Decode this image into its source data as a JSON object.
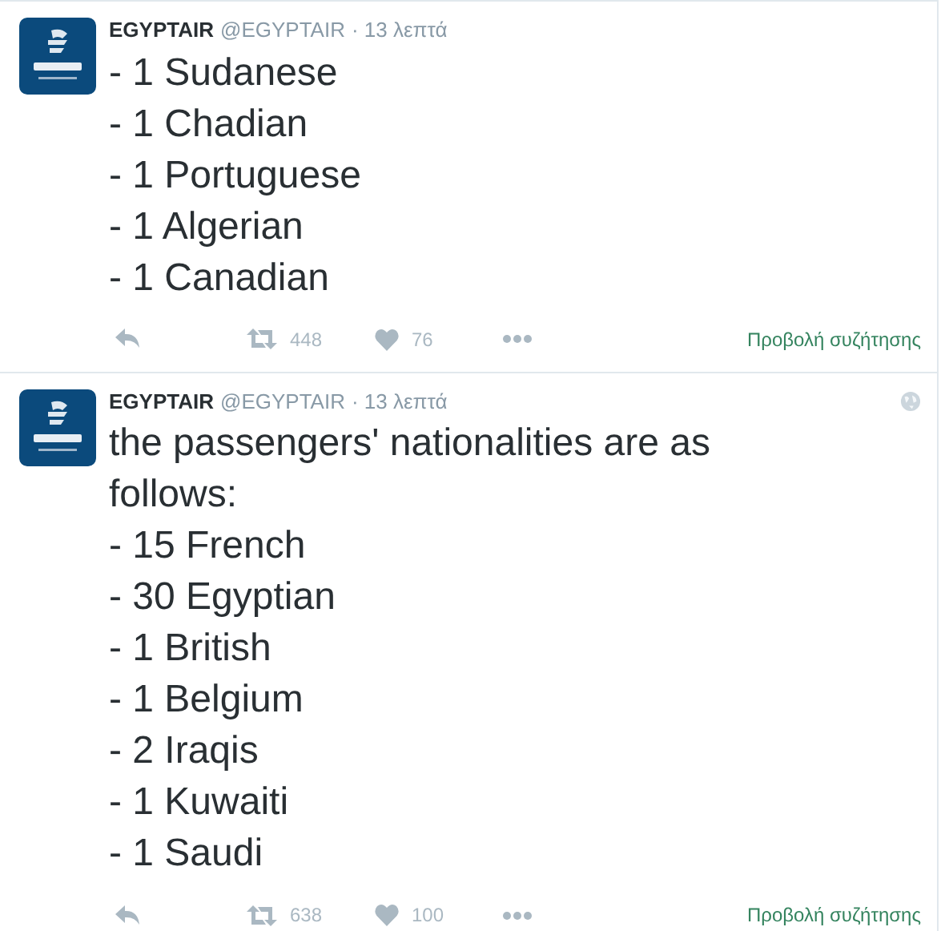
{
  "tweets": [
    {
      "name": "EGYPTAIR",
      "handle": "@EGYPTAIR",
      "time": "· 13 λεπτά",
      "globe": false,
      "text": "- 1 Sudanese\n- 1 Chadian\n- 1 Portuguese\n- 1 Algerian\n- 1 Canadian",
      "retweets": "448",
      "likes": "76",
      "conversation_link": "Προβολή συζήτησης"
    },
    {
      "name": "EGYPTAIR",
      "handle": "@EGYPTAIR",
      "time": "· 13 λεπτά",
      "globe": true,
      "text": "the passengers' nationalities are as follows:\n- 15 French\n- 30 Egyptian\n- 1 British\n- 1 Belgium\n- 2 Iraqis\n- 1 Kuwaiti\n- 1 Saudi",
      "retweets": "638",
      "likes": "100",
      "conversation_link": "Προβολή συζήτησης"
    }
  ]
}
